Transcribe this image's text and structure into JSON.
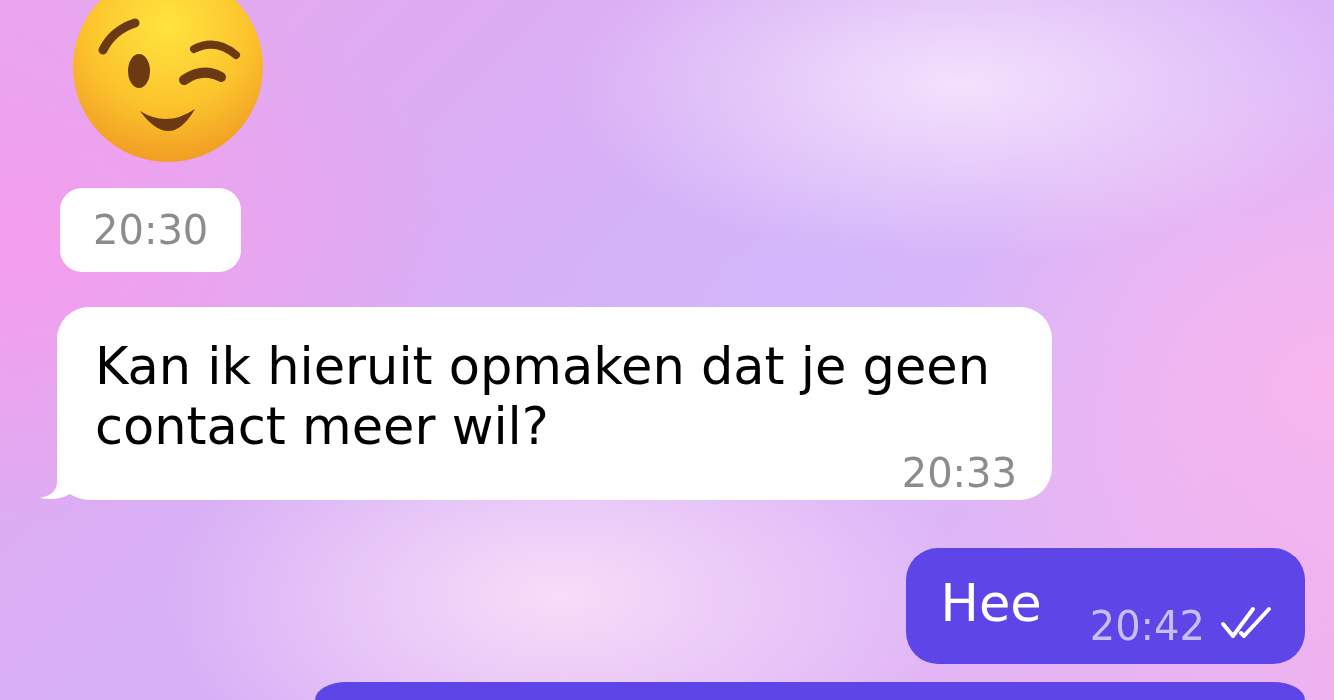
{
  "chat": {
    "messages": [
      {
        "kind": "emoji",
        "outgoing": false,
        "time": "20:30"
      },
      {
        "kind": "text",
        "outgoing": false,
        "text": "Kan ik hieruit opmaken dat je geen contact meer wil?",
        "time": "20:33"
      },
      {
        "kind": "text",
        "outgoing": true,
        "text": "Hee",
        "time": "20:42",
        "read": true
      },
      {
        "kind": "cut_off",
        "outgoing": true
      }
    ]
  }
}
